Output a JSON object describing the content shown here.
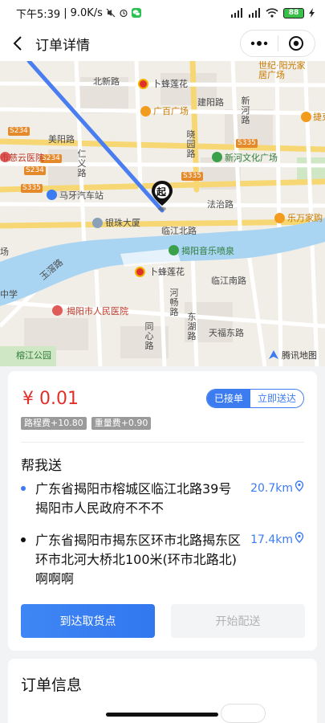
{
  "status_bar": {
    "time": "下午5:39",
    "speed": "9.0K/s",
    "battery": "88"
  },
  "nav": {
    "title": "订单详情"
  },
  "map": {
    "labels": {
      "beixin_road": "北新路",
      "bufeng_north": "卜蜂莲花",
      "jianyang_road": "建阳路",
      "xinhe_road": "新河路",
      "shiji_yangguang": "世纪·阳光家居广场",
      "guangbai": "广百广场",
      "xiaoyuan_road": "晓园路",
      "jiewan": "捷克购",
      "s234_a": "S234",
      "s234_b": "S234",
      "s234_c": "S234",
      "s335_a": "S335",
      "s335_b": "S335",
      "s335_c": "S335",
      "meiyang_road": "美阳路",
      "shi_rongyun_hospital": "市慈云医院",
      "renyi_road": "仁义路",
      "xinhe_culture": "新河文化广场",
      "maya_bus": "马牙汽车站",
      "fazhi_road": "法治路",
      "lewan": "乐万家购",
      "yinzhu": "银珠大厦",
      "linjiang_north": "临江北路",
      "music_fountain": "揭阳音乐喷泉",
      "yujian_road": "玉滘路",
      "bufeng_south": "卜蜂莲花",
      "linjiang_south": "临江南路",
      "middle_school": "中学",
      "people_hospital": "揭阳市人民医院",
      "hechang_road": "河畅路",
      "dongfu_road": "东湖路",
      "tongxin_road": "同心路",
      "tianfu_road": "天福东路",
      "rongjiang_park": "榕江公园",
      "chang_left": "场",
      "credit": "腾讯地图",
      "pin": "起"
    }
  },
  "order": {
    "fee": "¥ 0.01",
    "status_active": "已接单",
    "status_other": "立即送达",
    "tags": [
      "路程费+10.80",
      "重量费+0.90"
    ],
    "service": "帮我送",
    "pickup": {
      "address": "广东省揭阳市榕城区临江北路39号揭阳市人民政府不不不",
      "distance": "20.7km"
    },
    "dropoff": {
      "address": "广东省揭阳市揭东区环市北路揭东区环市北河大桥北100米(环市北路北)啊啊啊",
      "distance": "17.4km"
    },
    "primary_button": "到达取货点",
    "secondary_button": "开始配送"
  },
  "info": {
    "title": "订单信息"
  },
  "colors": {
    "accent": "#3c7cf0",
    "price": "#e0302b",
    "river": "#a9d4f2",
    "route": "#4a7ef0"
  }
}
